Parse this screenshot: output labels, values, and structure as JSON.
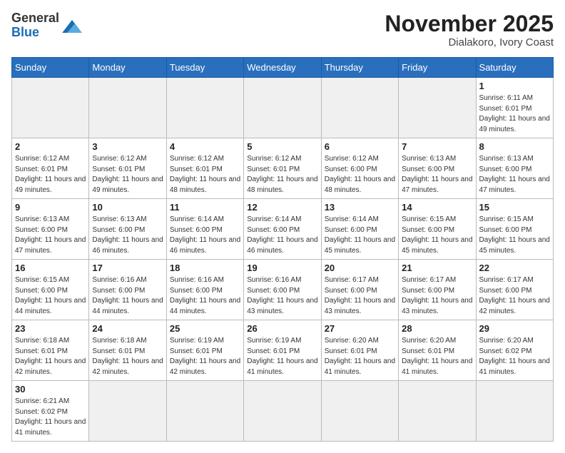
{
  "header": {
    "logo_general": "General",
    "logo_blue": "Blue",
    "month_year": "November 2025",
    "location": "Dialakoro, Ivory Coast"
  },
  "weekdays": [
    "Sunday",
    "Monday",
    "Tuesday",
    "Wednesday",
    "Thursday",
    "Friday",
    "Saturday"
  ],
  "weeks": [
    [
      {
        "day": "",
        "empty": true
      },
      {
        "day": "",
        "empty": true
      },
      {
        "day": "",
        "empty": true
      },
      {
        "day": "",
        "empty": true
      },
      {
        "day": "",
        "empty": true
      },
      {
        "day": "",
        "empty": true
      },
      {
        "day": "1",
        "sunrise": "Sunrise: 6:11 AM",
        "sunset": "Sunset: 6:01 PM",
        "daylight": "Daylight: 11 hours and 49 minutes."
      }
    ],
    [
      {
        "day": "2",
        "sunrise": "Sunrise: 6:12 AM",
        "sunset": "Sunset: 6:01 PM",
        "daylight": "Daylight: 11 hours and 49 minutes."
      },
      {
        "day": "3",
        "sunrise": "Sunrise: 6:12 AM",
        "sunset": "Sunset: 6:01 PM",
        "daylight": "Daylight: 11 hours and 49 minutes."
      },
      {
        "day": "4",
        "sunrise": "Sunrise: 6:12 AM",
        "sunset": "Sunset: 6:01 PM",
        "daylight": "Daylight: 11 hours and 48 minutes."
      },
      {
        "day": "5",
        "sunrise": "Sunrise: 6:12 AM",
        "sunset": "Sunset: 6:01 PM",
        "daylight": "Daylight: 11 hours and 48 minutes."
      },
      {
        "day": "6",
        "sunrise": "Sunrise: 6:12 AM",
        "sunset": "Sunset: 6:00 PM",
        "daylight": "Daylight: 11 hours and 48 minutes."
      },
      {
        "day": "7",
        "sunrise": "Sunrise: 6:13 AM",
        "sunset": "Sunset: 6:00 PM",
        "daylight": "Daylight: 11 hours and 47 minutes."
      },
      {
        "day": "8",
        "sunrise": "Sunrise: 6:13 AM",
        "sunset": "Sunset: 6:00 PM",
        "daylight": "Daylight: 11 hours and 47 minutes."
      }
    ],
    [
      {
        "day": "9",
        "sunrise": "Sunrise: 6:13 AM",
        "sunset": "Sunset: 6:00 PM",
        "daylight": "Daylight: 11 hours and 47 minutes."
      },
      {
        "day": "10",
        "sunrise": "Sunrise: 6:13 AM",
        "sunset": "Sunset: 6:00 PM",
        "daylight": "Daylight: 11 hours and 46 minutes."
      },
      {
        "day": "11",
        "sunrise": "Sunrise: 6:14 AM",
        "sunset": "Sunset: 6:00 PM",
        "daylight": "Daylight: 11 hours and 46 minutes."
      },
      {
        "day": "12",
        "sunrise": "Sunrise: 6:14 AM",
        "sunset": "Sunset: 6:00 PM",
        "daylight": "Daylight: 11 hours and 46 minutes."
      },
      {
        "day": "13",
        "sunrise": "Sunrise: 6:14 AM",
        "sunset": "Sunset: 6:00 PM",
        "daylight": "Daylight: 11 hours and 45 minutes."
      },
      {
        "day": "14",
        "sunrise": "Sunrise: 6:15 AM",
        "sunset": "Sunset: 6:00 PM",
        "daylight": "Daylight: 11 hours and 45 minutes."
      },
      {
        "day": "15",
        "sunrise": "Sunrise: 6:15 AM",
        "sunset": "Sunset: 6:00 PM",
        "daylight": "Daylight: 11 hours and 45 minutes."
      }
    ],
    [
      {
        "day": "16",
        "sunrise": "Sunrise: 6:15 AM",
        "sunset": "Sunset: 6:00 PM",
        "daylight": "Daylight: 11 hours and 44 minutes."
      },
      {
        "day": "17",
        "sunrise": "Sunrise: 6:16 AM",
        "sunset": "Sunset: 6:00 PM",
        "daylight": "Daylight: 11 hours and 44 minutes."
      },
      {
        "day": "18",
        "sunrise": "Sunrise: 6:16 AM",
        "sunset": "Sunset: 6:00 PM",
        "daylight": "Daylight: 11 hours and 44 minutes."
      },
      {
        "day": "19",
        "sunrise": "Sunrise: 6:16 AM",
        "sunset": "Sunset: 6:00 PM",
        "daylight": "Daylight: 11 hours and 43 minutes."
      },
      {
        "day": "20",
        "sunrise": "Sunrise: 6:17 AM",
        "sunset": "Sunset: 6:00 PM",
        "daylight": "Daylight: 11 hours and 43 minutes."
      },
      {
        "day": "21",
        "sunrise": "Sunrise: 6:17 AM",
        "sunset": "Sunset: 6:00 PM",
        "daylight": "Daylight: 11 hours and 43 minutes."
      },
      {
        "day": "22",
        "sunrise": "Sunrise: 6:17 AM",
        "sunset": "Sunset: 6:00 PM",
        "daylight": "Daylight: 11 hours and 42 minutes."
      }
    ],
    [
      {
        "day": "23",
        "sunrise": "Sunrise: 6:18 AM",
        "sunset": "Sunset: 6:01 PM",
        "daylight": "Daylight: 11 hours and 42 minutes."
      },
      {
        "day": "24",
        "sunrise": "Sunrise: 6:18 AM",
        "sunset": "Sunset: 6:01 PM",
        "daylight": "Daylight: 11 hours and 42 minutes."
      },
      {
        "day": "25",
        "sunrise": "Sunrise: 6:19 AM",
        "sunset": "Sunset: 6:01 PM",
        "daylight": "Daylight: 11 hours and 42 minutes."
      },
      {
        "day": "26",
        "sunrise": "Sunrise: 6:19 AM",
        "sunset": "Sunset: 6:01 PM",
        "daylight": "Daylight: 11 hours and 41 minutes."
      },
      {
        "day": "27",
        "sunrise": "Sunrise: 6:20 AM",
        "sunset": "Sunset: 6:01 PM",
        "daylight": "Daylight: 11 hours and 41 minutes."
      },
      {
        "day": "28",
        "sunrise": "Sunrise: 6:20 AM",
        "sunset": "Sunset: 6:01 PM",
        "daylight": "Daylight: 11 hours and 41 minutes."
      },
      {
        "day": "29",
        "sunrise": "Sunrise: 6:20 AM",
        "sunset": "Sunset: 6:02 PM",
        "daylight": "Daylight: 11 hours and 41 minutes."
      }
    ],
    [
      {
        "day": "30",
        "sunrise": "Sunrise: 6:21 AM",
        "sunset": "Sunset: 6:02 PM",
        "daylight": "Daylight: 11 hours and 41 minutes."
      },
      {
        "day": "",
        "empty": true
      },
      {
        "day": "",
        "empty": true
      },
      {
        "day": "",
        "empty": true
      },
      {
        "day": "",
        "empty": true
      },
      {
        "day": "",
        "empty": true
      },
      {
        "day": "",
        "empty": true
      }
    ]
  ]
}
